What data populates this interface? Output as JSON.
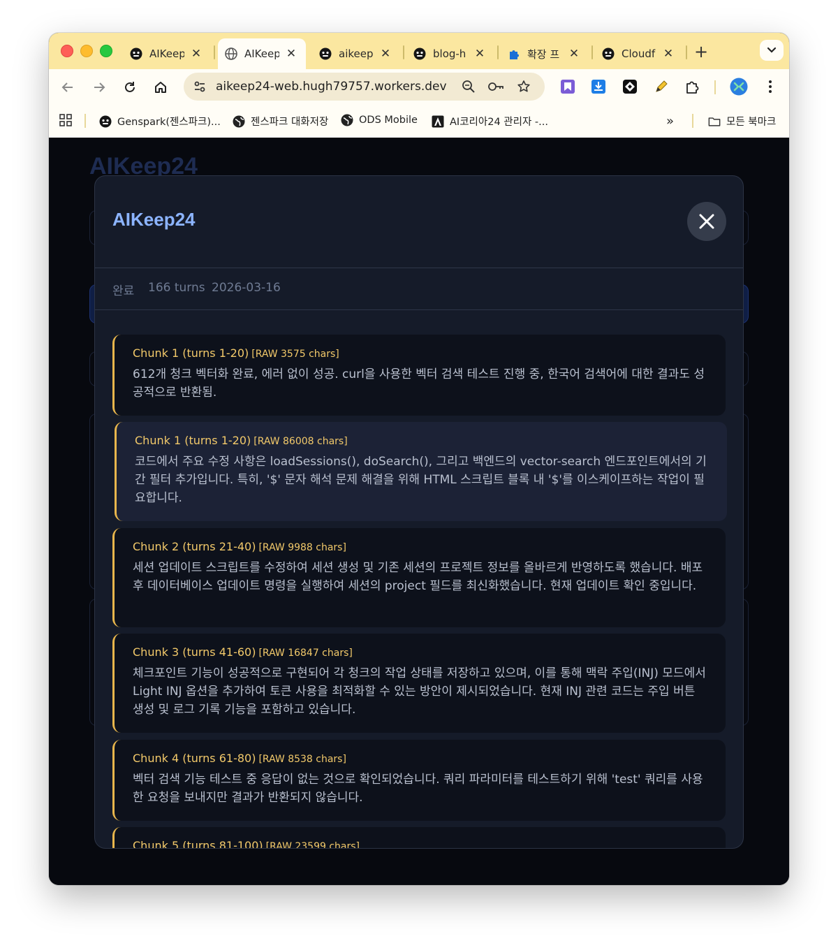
{
  "browser": {
    "tabs": [
      {
        "label": "AIKeep",
        "active": false
      },
      {
        "label": "AIKeep",
        "active": true
      },
      {
        "label": "aikeep",
        "active": false
      },
      {
        "label": "blog-h",
        "active": false
      },
      {
        "label": "확장 프",
        "active": false
      },
      {
        "label": "Cloudf",
        "active": false
      }
    ],
    "close_glyph": "✕",
    "new_tab_glyph": "+",
    "url": "aikeep24-web.hugh79757.workers.dev",
    "bookmarks": [
      {
        "label": "Genspark(젠스파크)..."
      },
      {
        "label": "젠스파크 대화저장"
      },
      {
        "label": "ODS Mobile"
      },
      {
        "label": "AI코리아24 관리자 -..."
      }
    ],
    "more_glyph": "»",
    "all_bookmarks": "모든 북마크"
  },
  "page": {
    "background_title": "AIKeep24"
  },
  "modal": {
    "title": "AIKeep24",
    "meta": {
      "status": "완료",
      "turns": "166 turns",
      "date": "2026-03-16"
    },
    "chunks": [
      {
        "title": "Chunk 1 (turns 1-20)",
        "raw": "[RAW 3575 chars]",
        "text": "612개 청크 벡터화 완료, 에러 없이 성공. curl을 사용한 벡터 검색 테스트 진행 중, 한국어 검색어에 대한 결과도 성공적으로 반환됨."
      },
      {
        "title": "Chunk 1 (turns 1-20)",
        "raw": "[RAW 86008 chars]",
        "text": "코드에서 주요 수정 사항은 loadSessions(), doSearch(), 그리고 백엔드의 vector-search 엔드포인트에서의 기간 필터 추가입니다. 특히, '$' 문자 해석 문제 해결을 위해 HTML 스크립트 블록 내 '$'를 이스케이프하는 작업이 필요합니다."
      },
      {
        "title": "Chunk 2 (turns 21-40)",
        "raw": "[RAW 9988 chars]",
        "text": "세션 업데이트 스크립트를 수정하여 세션 생성 및 기존 세션의 프로젝트 정보를 올바르게 반영하도록 했습니다. 배포 후 데이터베이스 업데이트 명령을 실행하여 세션의 project 필드를 최신화했습니다. 현재 업데이트 확인 중입니다."
      },
      {
        "title": "Chunk 3 (turns 41-60)",
        "raw": "[RAW 16847 chars]",
        "text": "체크포인트 기능이 성공적으로 구현되어 각 청크의 작업 상태를 저장하고 있으며, 이를 통해 맥락 주입(INJ) 모드에서 Light INJ 옵션을 추가하여 토큰 사용을 최적화할 수 있는 방안이 제시되었습니다. 현재 INJ 관련 코드는 주입 버튼 생성 및 로그 기록 기능을 포함하고 있습니다."
      },
      {
        "title": "Chunk 4 (turns 61-80)",
        "raw": "[RAW 8538 chars]",
        "text": "벡터 검색 기능 테스트 중 응답이 없는 것으로 확인되었습니다. 쿼리 파라미터를 테스트하기 위해 'test' 쿼리를 사용한 요청을 보내지만 결과가 반환되지 않습니다."
      },
      {
        "title": "Chunk 5 (turns 81-100)",
        "raw": "[RAW 23599 chars]",
        "text": ""
      }
    ]
  },
  "colors": {
    "accent_title": "#8cb4ff",
    "chunk_accent": "#e8b64c",
    "chrome_bg": "#fbe7a0"
  }
}
